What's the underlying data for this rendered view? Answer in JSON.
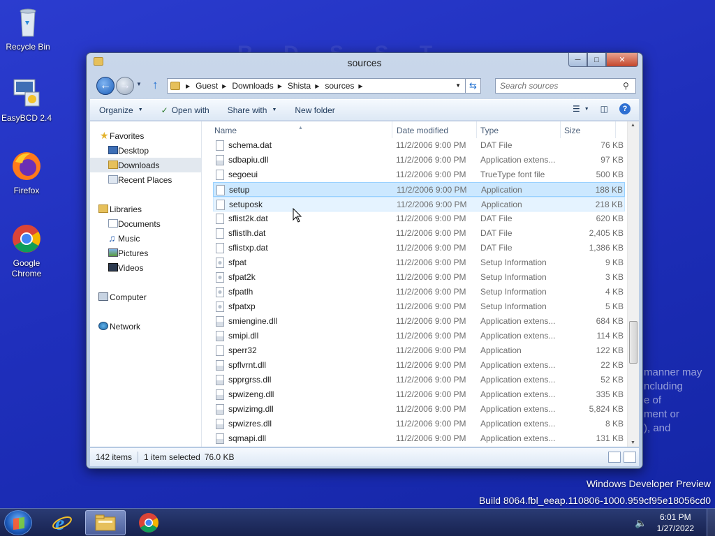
{
  "desktop": {
    "icons": [
      {
        "label": "Recycle Bin"
      },
      {
        "label": "EasyBCD 2.4"
      },
      {
        "label": "Firefox"
      },
      {
        "label": "Google Chrome"
      }
    ],
    "watermark_line1": "Windows Developer Preview",
    "watermark_line2": "Build 8064.fbl_eeap.110806-1000.959cf95e18056cd0",
    "bg_letters": "R D S S    T Z",
    "bg_text": "manner may\nncluding\ne of\nment or\n), and"
  },
  "window": {
    "title": "sources",
    "address": {
      "crumbs": [
        "Guest",
        "Downloads",
        "Shista",
        "sources"
      ]
    },
    "search_placeholder": "Search sources",
    "toolbar": {
      "organize": "Organize",
      "open_with": "Open with",
      "share_with": "Share with",
      "new_folder": "New folder"
    },
    "nav": {
      "favorites": "Favorites",
      "desktop": "Desktop",
      "downloads": "Downloads",
      "recent_places": "Recent Places",
      "libraries": "Libraries",
      "documents": "Documents",
      "music": "Music",
      "pictures": "Pictures",
      "videos": "Videos",
      "computer": "Computer",
      "network": "Network"
    },
    "columns": {
      "name": "Name",
      "date": "Date modified",
      "type": "Type",
      "size": "Size"
    },
    "files": [
      {
        "name": "schema.dat",
        "date": "11/2/2006 9:00 PM",
        "type": "DAT File",
        "size": "76 KB",
        "icon": "file"
      },
      {
        "name": "sdbapiu.dll",
        "date": "11/2/2006 9:00 PM",
        "type": "Application extens...",
        "size": "97 KB",
        "icon": "dll"
      },
      {
        "name": "segoeui",
        "date": "11/2/2006 9:00 PM",
        "type": "TrueType font file",
        "size": "500 KB",
        "icon": "file"
      },
      {
        "name": "setup",
        "date": "11/2/2006 9:00 PM",
        "type": "Application",
        "size": "188 KB",
        "icon": "file"
      },
      {
        "name": "setuposk",
        "date": "11/2/2006 9:00 PM",
        "type": "Application",
        "size": "218 KB",
        "icon": "file"
      },
      {
        "name": "sflist2k.dat",
        "date": "11/2/2006 9:00 PM",
        "type": "DAT File",
        "size": "620 KB",
        "icon": "file"
      },
      {
        "name": "sflistlh.dat",
        "date": "11/2/2006 9:00 PM",
        "type": "DAT File",
        "size": "2,405 KB",
        "icon": "file"
      },
      {
        "name": "sflistxp.dat",
        "date": "11/2/2006 9:00 PM",
        "type": "DAT File",
        "size": "1,386 KB",
        "icon": "file"
      },
      {
        "name": "sfpat",
        "date": "11/2/2006 9:00 PM",
        "type": "Setup Information",
        "size": "9 KB",
        "icon": "gear"
      },
      {
        "name": "sfpat2k",
        "date": "11/2/2006 9:00 PM",
        "type": "Setup Information",
        "size": "3 KB",
        "icon": "gear"
      },
      {
        "name": "sfpatlh",
        "date": "11/2/2006 9:00 PM",
        "type": "Setup Information",
        "size": "4 KB",
        "icon": "gear"
      },
      {
        "name": "sfpatxp",
        "date": "11/2/2006 9:00 PM",
        "type": "Setup Information",
        "size": "5 KB",
        "icon": "gear"
      },
      {
        "name": "smiengine.dll",
        "date": "11/2/2006 9:00 PM",
        "type": "Application extens...",
        "size": "684 KB",
        "icon": "dll"
      },
      {
        "name": "smipi.dll",
        "date": "11/2/2006 9:00 PM",
        "type": "Application extens...",
        "size": "114 KB",
        "icon": "dll"
      },
      {
        "name": "sperr32",
        "date": "11/2/2006 9:00 PM",
        "type": "Application",
        "size": "122 KB",
        "icon": "file"
      },
      {
        "name": "spflvrnt.dll",
        "date": "11/2/2006 9:00 PM",
        "type": "Application extens...",
        "size": "22 KB",
        "icon": "dll"
      },
      {
        "name": "spprgrss.dll",
        "date": "11/2/2006 9:00 PM",
        "type": "Application extens...",
        "size": "52 KB",
        "icon": "dll"
      },
      {
        "name": "spwizeng.dll",
        "date": "11/2/2006 9:00 PM",
        "type": "Application extens...",
        "size": "335 KB",
        "icon": "dll"
      },
      {
        "name": "spwizimg.dll",
        "date": "11/2/2006 9:00 PM",
        "type": "Application extens...",
        "size": "5,824 KB",
        "icon": "dll"
      },
      {
        "name": "spwizres.dll",
        "date": "11/2/2006 9:00 PM",
        "type": "Application extens...",
        "size": "8 KB",
        "icon": "dll"
      },
      {
        "name": "sqmapi.dll",
        "date": "11/2/2006 9:00 PM",
        "type": "Application extens...",
        "size": "131 KB",
        "icon": "dll"
      }
    ],
    "selected_file": "setup",
    "hovered_file": "setuposk",
    "status": {
      "items_count": "142 items",
      "selection": "1 item selected",
      "selection_size": "76.0 KB"
    }
  },
  "taskbar": {
    "time": "6:01 PM",
    "date": "1/27/2022"
  }
}
